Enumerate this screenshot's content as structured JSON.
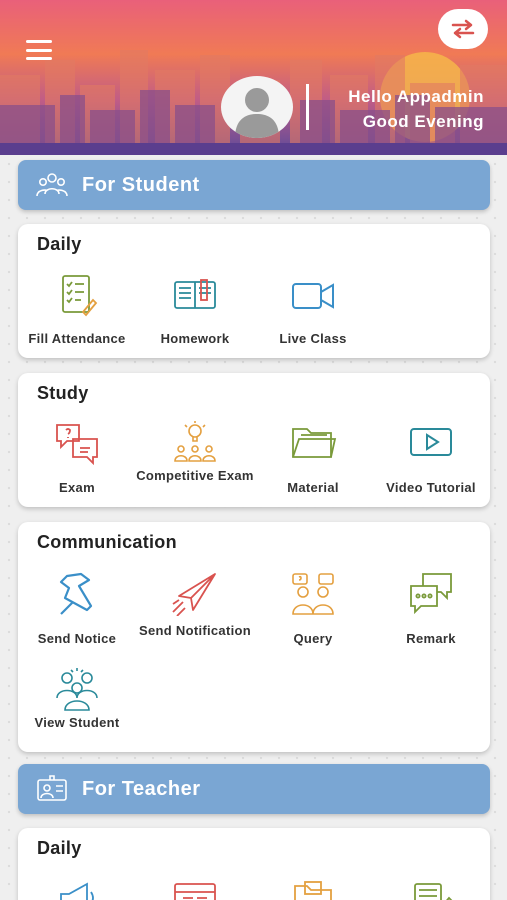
{
  "header": {
    "greeting_name": "Hello Appadmin",
    "greeting_time": "Good Evening"
  },
  "student_section": {
    "title": "For Student",
    "daily": {
      "title": "Daily",
      "items": [
        {
          "label": "Fill Attendance",
          "icon": "attendance-checklist-icon"
        },
        {
          "label": "Homework",
          "icon": "book-icon"
        },
        {
          "label": "Live Class",
          "icon": "video-camera-icon"
        }
      ]
    },
    "study": {
      "title": "Study",
      "items": [
        {
          "label": "Exam",
          "icon": "exam-chat-icon"
        },
        {
          "label": "Competitive Exam",
          "icon": "competitive-idea-icon"
        },
        {
          "label": "Material",
          "icon": "folder-icon"
        },
        {
          "label": "Video Tutorial",
          "icon": "play-video-icon"
        }
      ]
    },
    "communication": {
      "title": "Communication",
      "items": [
        {
          "label": "Send Notice",
          "icon": "pushpin-icon"
        },
        {
          "label": "Send Notification",
          "icon": "paper-plane-icon"
        },
        {
          "label": "Query",
          "icon": "query-people-icon"
        },
        {
          "label": "Remark",
          "icon": "speech-bubbles-icon"
        },
        {
          "label": "View Student",
          "icon": "student-group-icon"
        }
      ]
    }
  },
  "teacher_section": {
    "title": "For Teacher",
    "daily": {
      "title": "Daily"
    }
  },
  "colors": {
    "banner": "#7aa6d3",
    "icon_green": "#7a9a3a",
    "icon_teal": "#2a8a9a",
    "icon_red": "#d9534f",
    "icon_orange": "#e4a040",
    "icon_blue": "#3a8fc8"
  }
}
